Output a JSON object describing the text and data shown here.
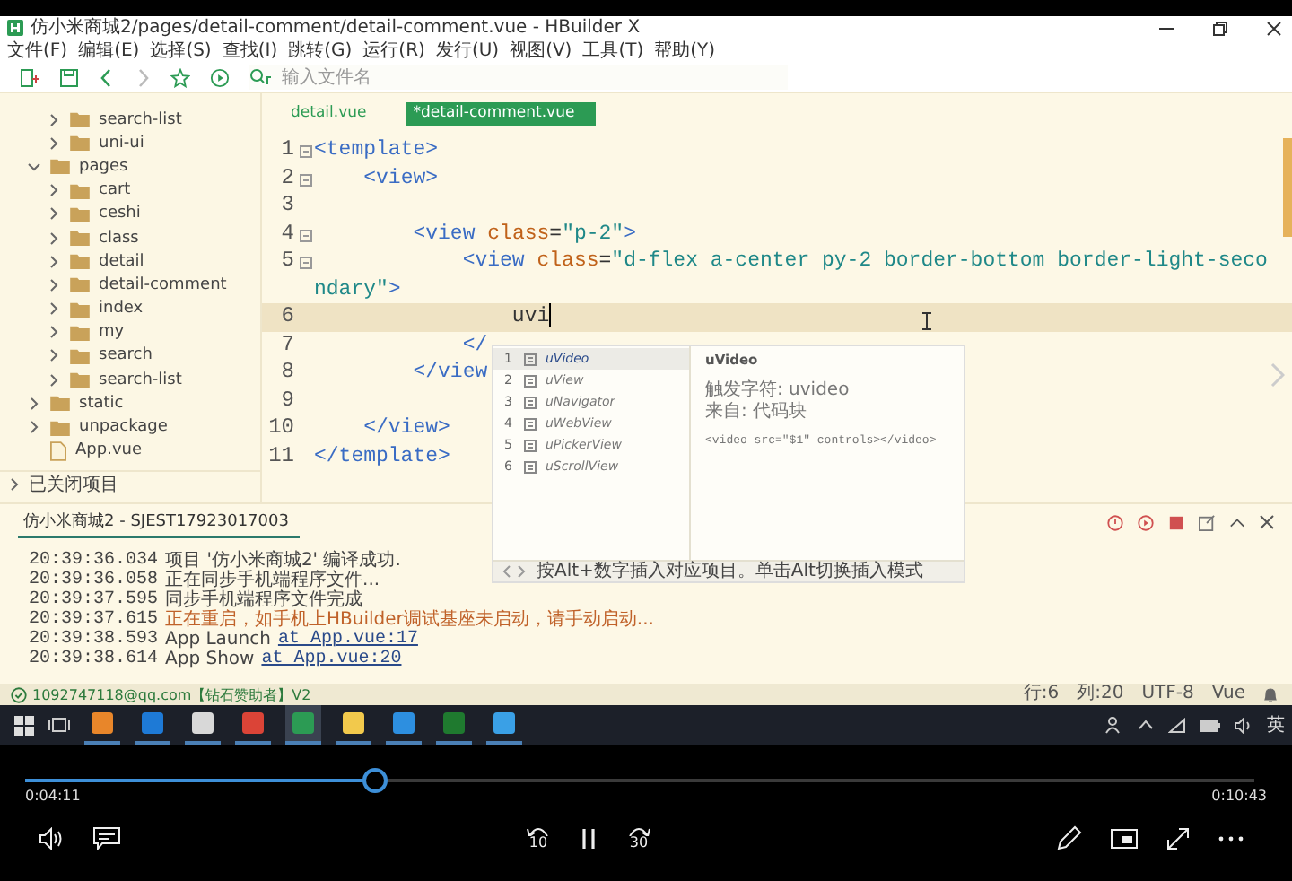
{
  "window": {
    "title": "仿小米商城2/pages/detail-comment/detail-comment.vue - HBuilder X"
  },
  "menu": [
    "文件(F)",
    "编辑(E)",
    "选择(S)",
    "查找(I)",
    "跳转(G)",
    "运行(R)",
    "发行(U)",
    "视图(V)",
    "工具(T)",
    "帮助(Y)"
  ],
  "toolbar": {
    "search": {
      "placeholder": "输入文件名"
    }
  },
  "sidebar": {
    "tree": [
      {
        "kind": "continued",
        "children": [
          {
            "name": "search-list",
            "kind": "folder",
            "expanded": false
          },
          {
            "name": "uni-ui",
            "kind": "folder",
            "expanded": false
          }
        ]
      },
      {
        "name": "pages",
        "kind": "folder",
        "expanded": true,
        "children": [
          {
            "name": "cart",
            "kind": "folder",
            "expanded": false
          },
          {
            "name": "ceshi",
            "kind": "folder",
            "expanded": false
          },
          {
            "name": "class",
            "kind": "folder",
            "expanded": false
          },
          {
            "name": "detail",
            "kind": "folder",
            "expanded": false
          },
          {
            "name": "detail-comment",
            "kind": "folder",
            "expanded": false
          },
          {
            "name": "index",
            "kind": "folder",
            "expanded": false
          },
          {
            "name": "my",
            "kind": "folder",
            "expanded": false
          },
          {
            "name": "search",
            "kind": "folder",
            "expanded": false
          },
          {
            "name": "search-list",
            "kind": "folder",
            "expanded": false
          }
        ]
      },
      {
        "name": "static",
        "kind": "folder",
        "expanded": false
      },
      {
        "name": "unpackage",
        "kind": "folder",
        "expanded": false
      },
      {
        "name": "App.vue",
        "kind": "file"
      }
    ],
    "closed_projects": "已关闭项目"
  },
  "editor": {
    "tabs": [
      {
        "label": "detail.vue",
        "selected": false
      },
      {
        "label": "*detail-comment.vue",
        "selected": true
      }
    ],
    "lines": [
      {
        "number": "1",
        "fold": true,
        "current": false,
        "tokens": [
          {
            "kind": "tag",
            "text": "<template>"
          }
        ]
      },
      {
        "number": "2",
        "fold": true,
        "current": false,
        "tokens": [
          {
            "kind": "tag",
            "text": "    <view>"
          }
        ]
      },
      {
        "number": "3",
        "fold": false,
        "current": false
      },
      {
        "number": "4",
        "fold": true,
        "current": false,
        "tokens": [
          {
            "kind": "tag",
            "text": "        <view "
          },
          {
            "kind": "attr",
            "text": "class"
          },
          {
            "kind": "plain",
            "text": "="
          },
          {
            "kind": "string",
            "text": "\"p-2\""
          },
          {
            "kind": "tag",
            "text": ">"
          }
        ]
      },
      {
        "number": "5",
        "fold": true,
        "current": false,
        "tokens": [
          {
            "kind": "tag",
            "text": "            <view "
          },
          {
            "kind": "attr",
            "text": "class"
          },
          {
            "kind": "plain",
            "text": "="
          },
          {
            "kind": "string",
            "text": "\"d-flex a-center py-2 border-bottom border-light-secondary\""
          },
          {
            "kind": "tag",
            "text": ">"
          }
        ]
      },
      {
        "number": "6",
        "fold": false,
        "current": true,
        "tokens": [
          {
            "kind": "plain",
            "text": "                uvi"
          }
        ]
      },
      {
        "number": "7",
        "fold": false,
        "current": false,
        "tokens": [
          {
            "kind": "tag",
            "text": "            </"
          }
        ]
      },
      {
        "number": "8",
        "fold": false,
        "current": false,
        "tokens": [
          {
            "kind": "tag",
            "text": "        </view"
          }
        ]
      },
      {
        "number": "9",
        "fold": false,
        "current": false
      },
      {
        "number": "10",
        "fold": false,
        "current": false,
        "tokens": [
          {
            "kind": "tag",
            "text": "    </view>"
          }
        ]
      },
      {
        "number": "11",
        "fold": false,
        "current": false,
        "tokens": [
          {
            "kind": "tag",
            "text": "</template>"
          }
        ]
      }
    ]
  },
  "autocomplete": {
    "items": [
      {
        "number": "1",
        "label": "uVideo",
        "selected": true
      },
      {
        "number": "2",
        "label": "uView",
        "selected": false
      },
      {
        "number": "3",
        "label": "uNavigator",
        "selected": false
      },
      {
        "number": "4",
        "label": "uWebView",
        "selected": false
      },
      {
        "number": "5",
        "label": "uPickerView",
        "selected": false
      },
      {
        "number": "6",
        "label": "uScrollView",
        "selected": false
      }
    ],
    "detail": {
      "title": "uVideo",
      "trigger": "触发字符: uvideo",
      "source": "来自: 代码块",
      "snippet": "<video src=\"$1\" controls></video>"
    },
    "hint": "按Alt+数字插入对应项目。单击Alt切换插入模式"
  },
  "console": {
    "tab": "仿小米商城2 - SJEST17923017003",
    "lines": [
      {
        "time": "20:39:36.034",
        "kind": "info",
        "message": "项目 '仿小米商城2' 编译成功."
      },
      {
        "time": "20:39:36.058",
        "kind": "info",
        "message": "正在同步手机端程序文件..."
      },
      {
        "time": "20:39:37.595",
        "kind": "info",
        "message": "同步手机端程序文件完成"
      },
      {
        "time": "20:39:37.615",
        "kind": "warning",
        "message": "正在重启，如手机上HBuilder调试基座未启动，请手动启动..."
      },
      {
        "time": "20:39:38.593",
        "kind": "info",
        "message": "App Launch",
        "link": "at App.vue:17"
      },
      {
        "time": "20:39:38.614",
        "kind": "info",
        "message": "App Show",
        "link": "at App.vue:20"
      }
    ]
  },
  "status_bar": {
    "account": "1092747118@qq.com【钻石赞助者】V2",
    "line": "行:6",
    "column": "列:20",
    "encoding": "UTF-8",
    "language": "Vue"
  },
  "taskbar": {
    "apps": [
      {
        "kind": "sublime",
        "selected": false
      },
      {
        "kind": "edge",
        "selected": false
      },
      {
        "kind": "notes",
        "selected": false
      },
      {
        "kind": "chrome",
        "selected": false
      },
      {
        "kind": "hbuilder",
        "selected": true
      },
      {
        "kind": "folder",
        "selected": false
      },
      {
        "kind": "cloud",
        "selected": false
      },
      {
        "kind": "terminal",
        "selected": false
      },
      {
        "kind": "camera",
        "selected": false
      }
    ],
    "ime": "英"
  },
  "player": {
    "level": 0.285,
    "elapsed": "0:04:11",
    "duration": "0:10:43",
    "rewind": "10",
    "forward": "30",
    "playing": true
  }
}
